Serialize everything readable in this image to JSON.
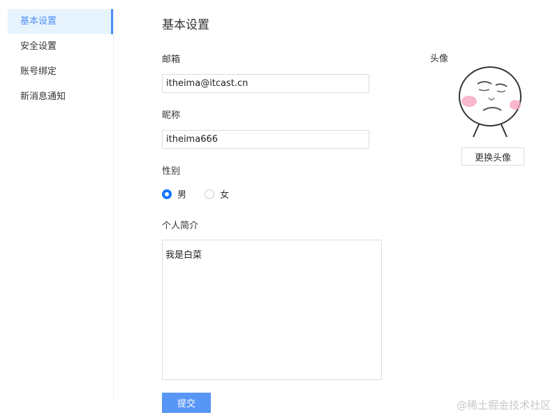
{
  "sidebar": {
    "items": [
      {
        "label": "基本设置",
        "active": true
      },
      {
        "label": "安全设置"
      },
      {
        "label": "账号绑定"
      },
      {
        "label": "新消息通知"
      }
    ]
  },
  "main": {
    "title": "基本设置",
    "email": {
      "label": "邮箱",
      "value": "itheima@itcast.cn"
    },
    "nickname": {
      "label": "昵称",
      "value": "itheima666"
    },
    "gender": {
      "label": "性别",
      "options": [
        "男",
        "女"
      ],
      "selected": "男"
    },
    "bio": {
      "label": "个人简介",
      "value": "我是白菜"
    },
    "submit_label": "提交"
  },
  "avatar": {
    "label": "头像",
    "change_label": "更换头像"
  },
  "watermark": "@稀土掘金技术社区",
  "colors": {
    "accent": "#4e8ef7",
    "active_bg": "#e8f4fd"
  }
}
